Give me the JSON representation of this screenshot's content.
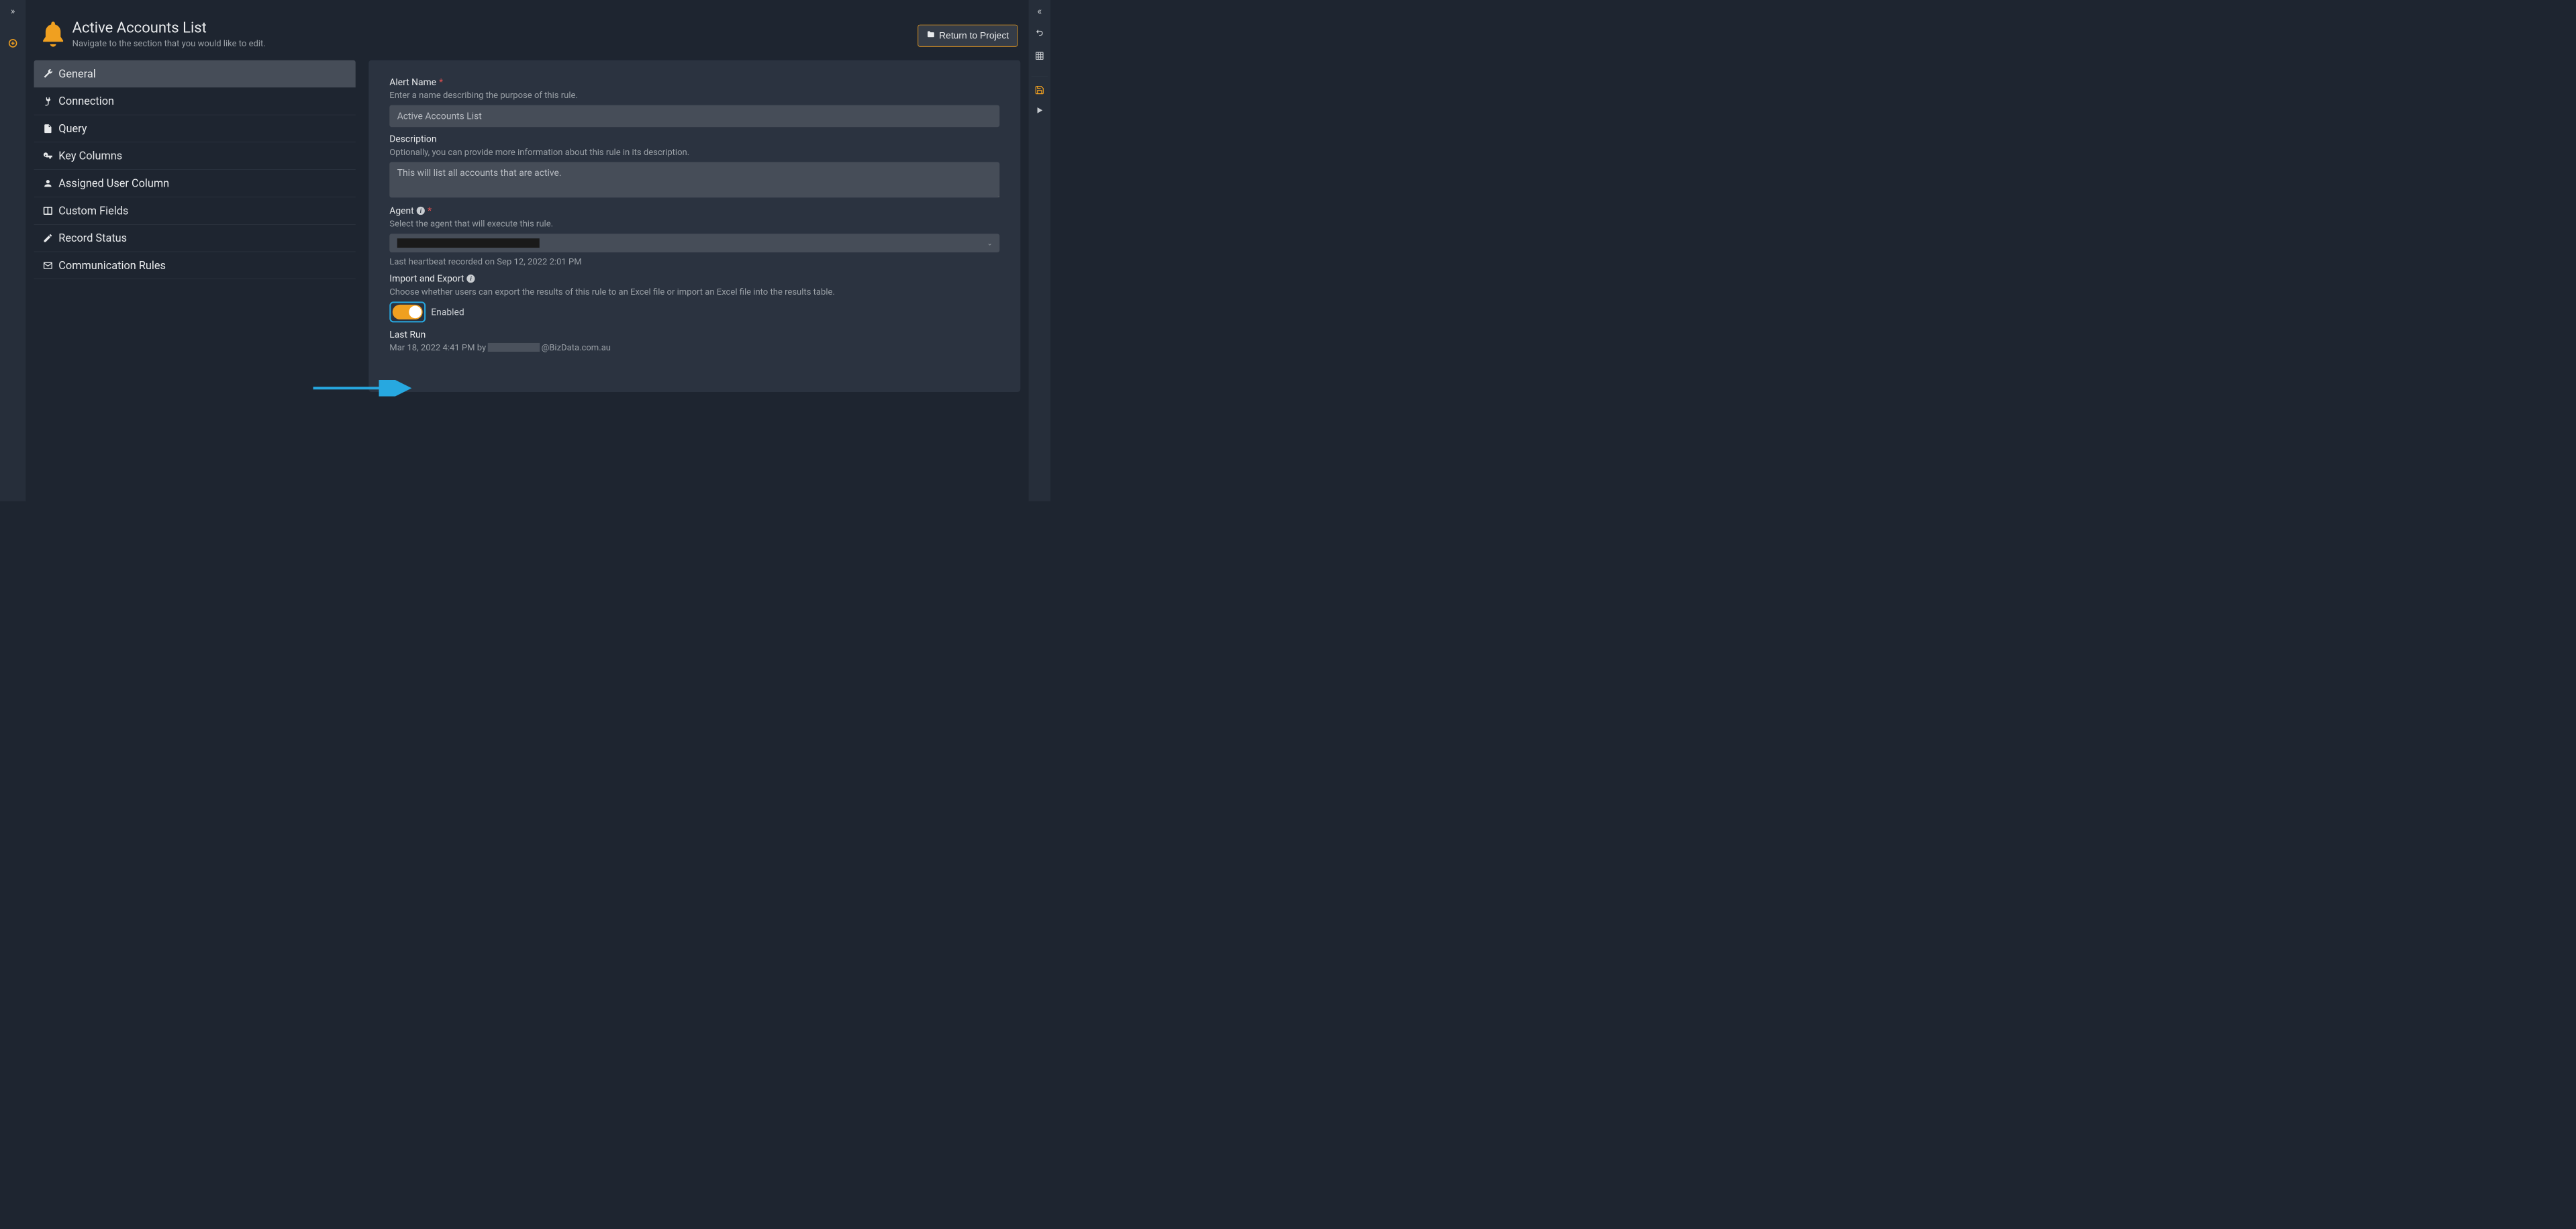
{
  "header": {
    "title": "Active Accounts List",
    "subtitle": "Navigate to the section that you would like to edit.",
    "return_button": "Return to Project"
  },
  "nav": {
    "items": [
      {
        "label": "General"
      },
      {
        "label": "Connection"
      },
      {
        "label": "Query"
      },
      {
        "label": "Key Columns"
      },
      {
        "label": "Assigned User Column"
      },
      {
        "label": "Custom Fields"
      },
      {
        "label": "Record Status"
      },
      {
        "label": "Communication Rules"
      }
    ]
  },
  "form": {
    "alert_name": {
      "label": "Alert Name",
      "help": "Enter a name describing the purpose of this rule.",
      "value": "Active Accounts List"
    },
    "description": {
      "label": "Description",
      "help": "Optionally, you can provide more information about this rule in its description.",
      "value": "This will list all accounts that are active."
    },
    "agent": {
      "label": "Agent",
      "help": "Select the agent that will execute this rule.",
      "heartbeat": "Last heartbeat recorded on Sep 12, 2022 2:01 PM"
    },
    "import_export": {
      "label": "Import and Export",
      "help": "Choose whether users can export the results of this rule to an Excel file or import an Excel file into the results table.",
      "toggle_label": "Enabled"
    },
    "last_run": {
      "label": "Last Run",
      "prefix": "Mar 18, 2022 4:41 PM by ",
      "suffix": "@BizData.com.au"
    }
  }
}
